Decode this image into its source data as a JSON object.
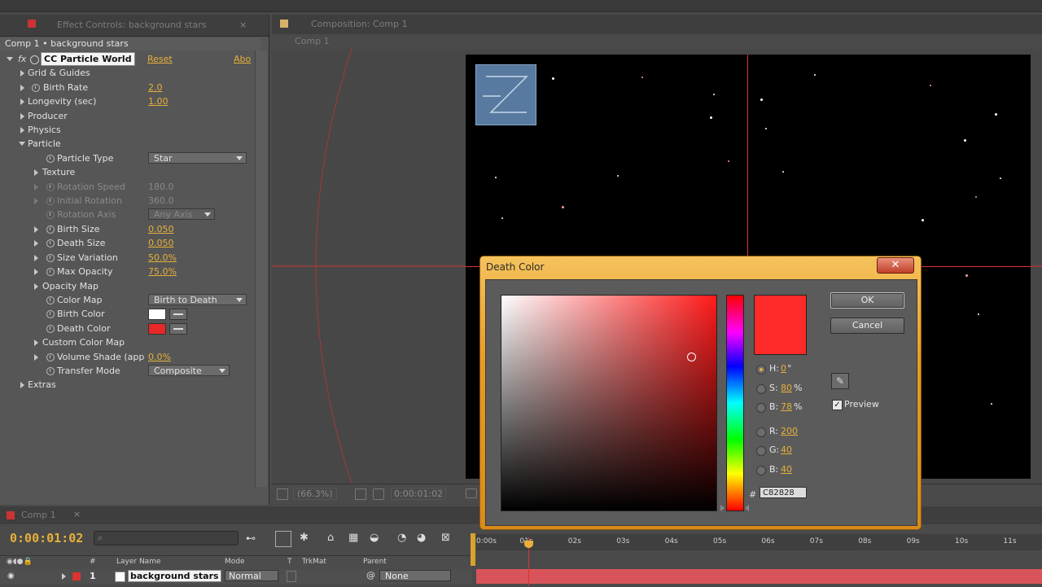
{
  "effect_panel": {
    "tab_title": "Effect Controls: background stars",
    "comp_label": "Comp 1 • background stars",
    "effect_name": "CC Particle World",
    "reset_label": "Reset",
    "about_label": "Abo",
    "rows": {
      "grid": "Grid & Guides",
      "birth_rate": "Birth Rate",
      "birth_rate_val": "2.0",
      "longevity": "Longevity (sec)",
      "longevity_val": "1.00",
      "producer": "Producer",
      "physics": "Physics",
      "particle": "Particle",
      "particle_type": "Particle Type",
      "particle_type_val": "Star",
      "texture": "Texture",
      "rotation_speed": "Rotation Speed",
      "rotation_speed_val": "180.0",
      "initial_rotation": "Initial Rotation",
      "initial_rotation_val": "360.0",
      "rotation_axis": "Rotation Axis",
      "rotation_axis_val": "Any Axis",
      "birth_size": "Birth Size",
      "birth_size_val": "0.050",
      "death_size": "Death Size",
      "death_size_val": "0.050",
      "size_variation": "Size Variation",
      "size_variation_val": "50.0%",
      "max_opacity": "Max Opacity",
      "max_opacity_val": "75.0%",
      "opacity_map": "Opacity Map",
      "color_map": "Color Map",
      "color_map_val": "Birth to Death",
      "birth_color": "Birth Color",
      "death_color": "Death Color",
      "custom_color_map": "Custom Color Map",
      "volume_shade": "Volume Shade (app",
      "volume_shade_val": "0.0%",
      "transfer_mode": "Transfer Mode",
      "transfer_mode_val": "Composite",
      "extras": "Extras"
    },
    "colors": {
      "birth": "#ffffff",
      "death": "#e82828"
    }
  },
  "composition": {
    "tab_title": "Composition: Comp 1",
    "breadcrumb": "Comp 1",
    "zoom": "(66.3%)",
    "timecode": "0:00:01:02"
  },
  "dialog": {
    "title": "Death Color",
    "close": "✕",
    "ok": "OK",
    "cancel": "Cancel",
    "preview_label": "Preview",
    "h_label": "H:",
    "h_val": "0",
    "h_unit": "°",
    "s_label": "S:",
    "s_val": "80",
    "s_unit": "%",
    "b_label": "B:",
    "b_val": "78",
    "b_unit": "%",
    "r_label": "R:",
    "r_val": "200",
    "g_label": "G:",
    "g_val": "40",
    "bl_label": "B:",
    "bl_val": "40",
    "hex_prefix": "#",
    "hex_val": "C82828",
    "preview_color": "#ff2a2a"
  },
  "timeline": {
    "tab_title": "Comp 1",
    "timecode": "0:00:01:02",
    "ticks": [
      "0:00s",
      "01s",
      "02s",
      "03s",
      "04s",
      "05s",
      "06s",
      "07s",
      "08s",
      "09s",
      "10s",
      "11s"
    ],
    "col_layer_name": "Layer Name",
    "col_mode": "Mode",
    "col_t": "T",
    "col_trkmat": "TrkMat",
    "col_parent": "Parent",
    "col_hash": "#",
    "layer": {
      "index": "1",
      "name": "background stars",
      "mode": "Normal",
      "parent": "None"
    }
  }
}
